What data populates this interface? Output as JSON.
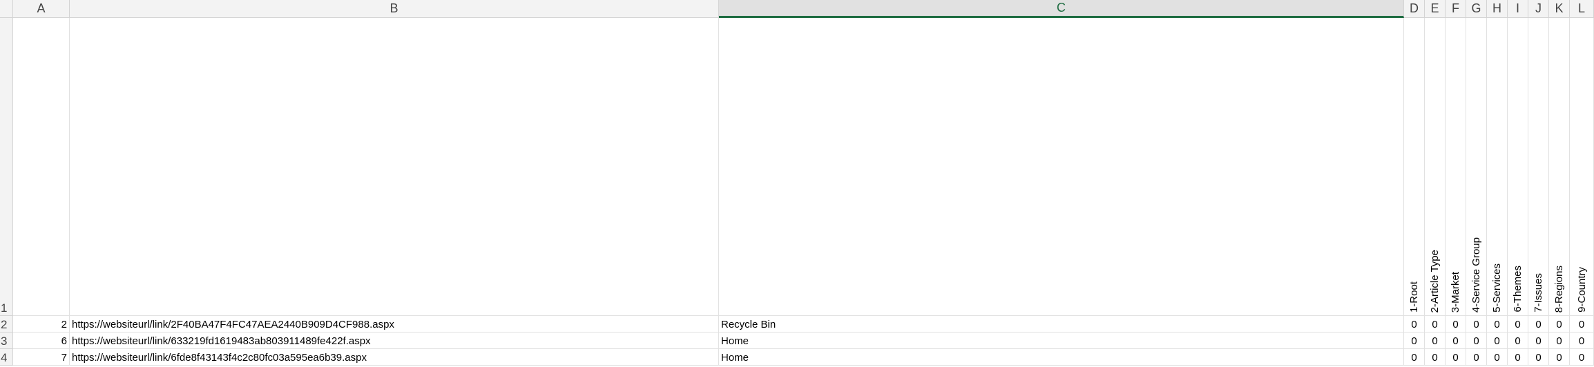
{
  "columns": [
    "A",
    "B",
    "C",
    "D",
    "E",
    "F",
    "G",
    "H",
    "I",
    "J",
    "K",
    "L"
  ],
  "selected_column": "C",
  "rows": [
    {
      "row_num": "1"
    },
    {
      "row_num": "2"
    },
    {
      "row_num": "3"
    },
    {
      "row_num": "4"
    }
  ],
  "header_cells": [
    "1-Root",
    "2-Article Type",
    "3-Market",
    "4-Service Group",
    "5-Services",
    "6-Themes",
    "7-Issues",
    "8-Regions",
    "9-Country"
  ],
  "data_rows": [
    {
      "a": "2",
      "b": "https://websiteurl/link/2F40BA47F4FC47AEA2440B909D4CF988.aspx",
      "c": "Recycle Bin",
      "vals": [
        "0",
        "0",
        "0",
        "0",
        "0",
        "0",
        "0",
        "0",
        "0"
      ]
    },
    {
      "a": "6",
      "b": "https://websiteurl/link/633219fd1619483ab803911489fe422f.aspx",
      "c": "Home",
      "vals": [
        "0",
        "0",
        "0",
        "0",
        "0",
        "0",
        "0",
        "0",
        "0"
      ]
    },
    {
      "a": "7",
      "b": "https://websiteurl/link/6fde8f43143f4c2c80fc03a595ea6b39.aspx",
      "c": "Home",
      "vals": [
        "0",
        "0",
        "0",
        "0",
        "0",
        "0",
        "0",
        "0",
        "0"
      ]
    }
  ],
  "colors": {
    "selected_header_accent": "#1e6c41",
    "header_bg": "#f3f3f3",
    "gridline": "#e1e1e1"
  }
}
